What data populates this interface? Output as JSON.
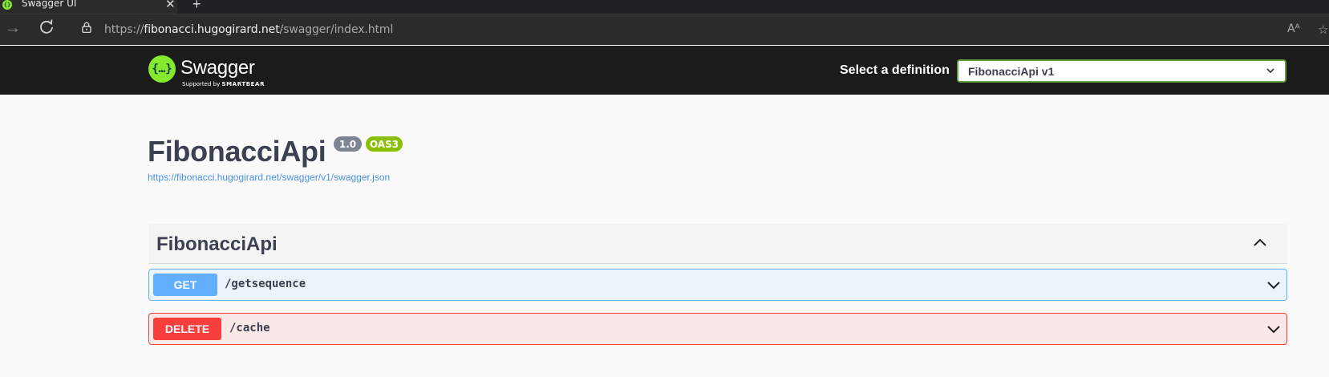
{
  "browser": {
    "tab_title": "Swagger UI",
    "tab_close": "✕",
    "new_tab": "+",
    "url_scheme": "https://",
    "url_host": "fibonacci.hugogirard.net",
    "url_path": "/swagger/index.html",
    "read_aloud": "Aᴬ",
    "favorite": "☆"
  },
  "topbar": {
    "logo_glyph": "{…}",
    "logo_text": "Swagger",
    "logo_supported": "Supported by",
    "logo_smartbear": "SMARTBEAR",
    "select_label": "Select a definition",
    "selected_definition": "FibonacciApi v1",
    "accent_color": "#85ea2d"
  },
  "info": {
    "title": "FibonacciApi",
    "version": "1.0",
    "oas": "OAS3",
    "spec_url": "https://fibonacci.hugogirard.net/swagger/v1/swagger.json"
  },
  "tags": [
    {
      "name": "FibonacciApi",
      "expanded": true,
      "operations": [
        {
          "method": "GET",
          "path": "/getsequence",
          "color": "#61affe"
        },
        {
          "method": "DELETE",
          "path": "/cache",
          "color": "#f93e3e"
        }
      ]
    }
  ]
}
